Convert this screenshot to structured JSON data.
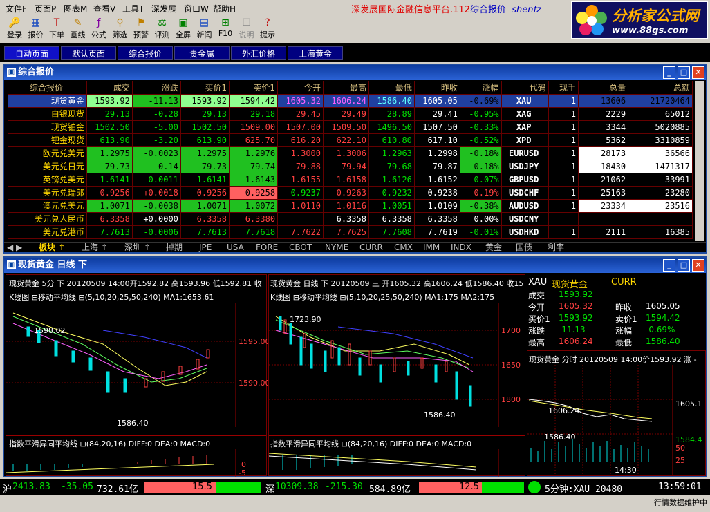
{
  "menu": [
    "文件F",
    "页面P",
    "图表M",
    "查看V",
    "工具T",
    "深发展",
    "窗口W",
    "帮助H"
  ],
  "banner": {
    "text": "深发展国际金融信息平台.112",
    "link": "综合报价",
    "user": "shenfz"
  },
  "logo": {
    "title": "分析家公式网",
    "url": "www.88gs.com"
  },
  "toolbar": [
    "登录",
    "报价",
    "下单",
    "画线",
    "公式",
    "筛选",
    "预警",
    "评测",
    "全屏",
    "新闻",
    "F10",
    "说明",
    "提示"
  ],
  "toolbar_icons": [
    "login-icon",
    "quote-icon",
    "order-icon",
    "draw-icon",
    "formula-icon",
    "filter-icon",
    "alert-icon",
    "test-icon",
    "fullscreen-icon",
    "news-icon",
    "f10-icon",
    "help-icon",
    "tip-icon"
  ],
  "nav": [
    "自动页面",
    "默认页面",
    "综合报价",
    "贵金属",
    "外汇价格",
    "上海黄金"
  ],
  "quote_window": {
    "title": "综合报价",
    "headers": [
      "综合报价",
      "成交",
      "涨跌",
      "买价1",
      "卖价1",
      "今开",
      "最高",
      "最低",
      "昨收",
      "涨幅",
      "代码",
      "现手",
      "总量",
      "总额"
    ],
    "rows": [
      [
        "现货黄金",
        "1593.92",
        "-11.13",
        "1593.92",
        "1594.42",
        "1605.32",
        "1606.24",
        "1586.40",
        "1605.05",
        "-0.69%",
        "XAU",
        "1",
        "13606",
        "21720464"
      ],
      [
        "白银现货",
        "29.13",
        "-0.28",
        "29.13",
        "29.18",
        "29.45",
        "29.49",
        "28.89",
        "29.41",
        "-0.95%",
        "XAG",
        "1",
        "2229",
        "65012"
      ],
      [
        "现货铂金",
        "1502.50",
        "-5.00",
        "1502.50",
        "1509.00",
        "1507.00",
        "1509.50",
        "1496.50",
        "1507.50",
        "-0.33%",
        "XAP",
        "1",
        "3344",
        "5020885"
      ],
      [
        "钯金现货",
        "613.90",
        "-3.20",
        "613.90",
        "625.70",
        "616.20",
        "622.10",
        "610.80",
        "617.10",
        "-0.52%",
        "XPD",
        "1",
        "5362",
        "3310859"
      ],
      [
        "欧元兑美元",
        "1.2975",
        "-0.0023",
        "1.2975",
        "1.2976",
        "1.3000",
        "1.3006",
        "1.2963",
        "1.2998",
        "-0.18%",
        "EURUSD",
        "1",
        "28173",
        "36566"
      ],
      [
        "美元兑日元",
        "79.73",
        "-0.14",
        "79.73",
        "79.74",
        "79.88",
        "79.94",
        "79.68",
        "79.87",
        "-0.18%",
        "USDJPY",
        "1",
        "18430",
        "1471317"
      ],
      [
        "英镑兑美元",
        "1.6141",
        "-0.0011",
        "1.6141",
        "1.6143",
        "1.6155",
        "1.6158",
        "1.6126",
        "1.6152",
        "-0.07%",
        "GBPUSD",
        "1",
        "21062",
        "33991"
      ],
      [
        "美元兑瑞郎",
        "0.9256",
        "+0.0018",
        "0.9256",
        "0.9258",
        "0.9237",
        "0.9263",
        "0.9232",
        "0.9238",
        "0.19%",
        "USDCHF",
        "1",
        "25163",
        "23280"
      ],
      [
        "澳元兑美元",
        "1.0071",
        "-0.0038",
        "1.0071",
        "1.0072",
        "1.0110",
        "1.0116",
        "1.0051",
        "1.0109",
        "-0.38%",
        "AUDUSD",
        "1",
        "23334",
        "23516"
      ],
      [
        "美元兑人民币",
        "6.3358",
        "+0.0000",
        "6.3358",
        "6.3380",
        "",
        "6.3358",
        "6.3358",
        "6.3358",
        "0.00%",
        "USDCNY",
        "",
        "",
        ""
      ],
      [
        "美元兑港币",
        "7.7613",
        "-0.0006",
        "7.7613",
        "7.7618",
        "7.7622",
        "7.7625",
        "7.7608",
        "7.7619",
        "-0.01%",
        "USDHKD",
        "1",
        "2111",
        "16385"
      ]
    ],
    "tabs": [
      "板块 ↑",
      "上海 ↑",
      "深圳 ↑",
      "掉期",
      "JPE",
      "USA",
      "FORE",
      "CBOT",
      "NYME",
      "CURR",
      "CMX",
      "IMM",
      "INDX",
      "黄金",
      "国债",
      "利率"
    ]
  },
  "chart_window": {
    "title": "现货黄金  日线  下",
    "left_header": "现货黄金 5分 下 20120509 14:00开1592.82 高1593.96 低1592.81 收",
    "left_kline": "K线图 ⊟移动平均线 ⊟(5,10,20,25,50,240) MA1:1653.61",
    "left_labels": [
      "1598.02",
      "1586.40",
      "1595.00",
      "1590.00"
    ],
    "left_macd": "指数平滑异同平均线 ⊟(84,20,16) DIFF:0 DEA:0 MACD:0",
    "left_macd_axis": [
      "0",
      "-5"
    ],
    "mid_header": "现货黄金 日线 下 20120509 三 开1605.32 高1606.24 低1586.40 收15",
    "mid_kline": "K线图 ⊟移动平均线 ⊟(5,10,20,25,50,240) MA1:175 MA2:175",
    "mid_labels": [
      "1723.90",
      "1586.40",
      "1700",
      "1650",
      "1800"
    ],
    "mid_macd": "指数平滑异同平均线 ⊟(84,20,16) DIFF:0 DEA:0 MACD:0",
    "info": {
      "code": "XAU",
      "name": "现货黄金",
      "market": "CURR",
      "rows": [
        [
          "成交",
          "1593.92",
          "",
          ""
        ],
        [
          "今开",
          "1605.32",
          "昨收",
          "1605.05"
        ],
        [
          "买价1",
          "1593.92",
          "卖价1",
          "1594.42"
        ],
        [
          "涨跌",
          "-11.13",
          "涨幅",
          "-0.69%"
        ],
        [
          "最高",
          "1606.24",
          "最低",
          "1586.40"
        ]
      ]
    },
    "minute_header": "现货黄金 分时 20120509 14:00价1593.92 涨 -",
    "minute_labels": [
      "1606.24",
      "1586.40",
      "1605.1",
      "1584.4",
      "50",
      "25",
      "14:30"
    ]
  },
  "status": {
    "sh_label": "沪",
    "sh_index": "2413.83",
    "sh_change": "-35.05",
    "sh_amount": "732.61亿",
    "sh_ratio": "15.5",
    "sz_label": "深",
    "sz_index": "10309.38",
    "sz_change": "-215.30",
    "sz_amount": "584.89亿",
    "sz_ratio": "12.5",
    "ticker": "5分钟:XAU 20480",
    "clock": "13:59:01",
    "notice": "行情数据维护中"
  }
}
